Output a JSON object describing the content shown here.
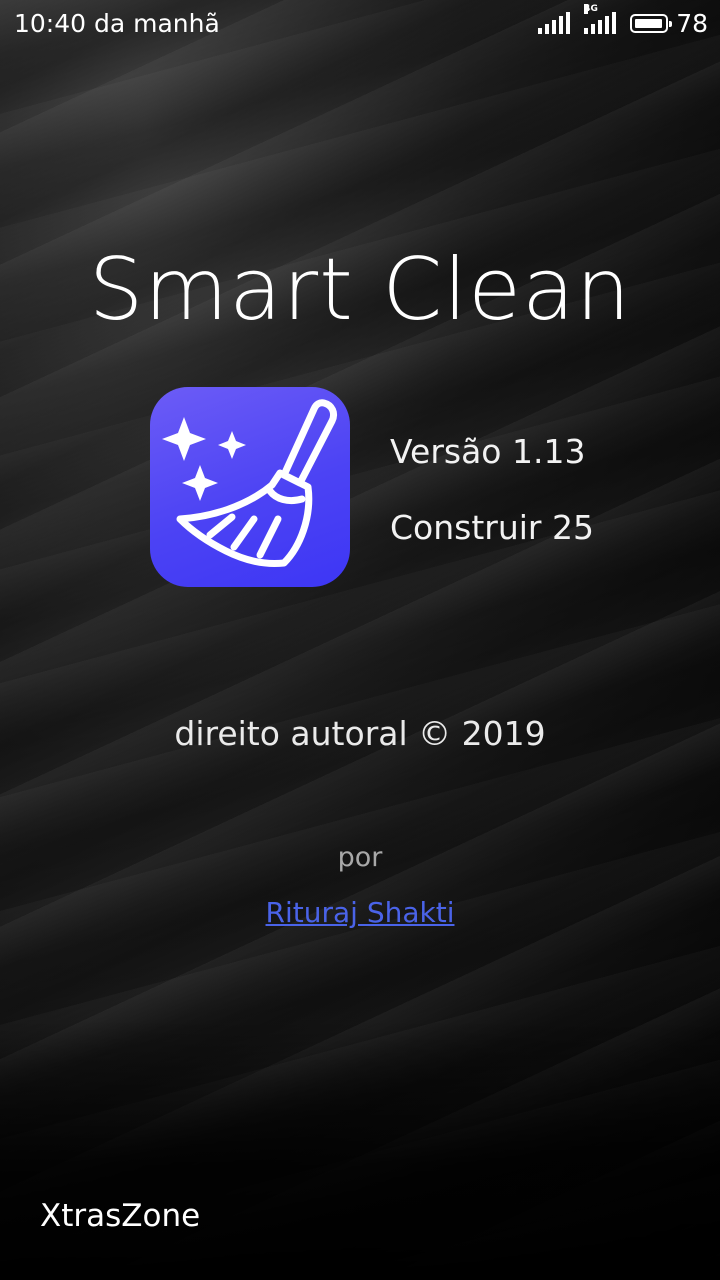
{
  "status_bar": {
    "time": "10:40 da manhã",
    "network_label": "4G",
    "battery_level": "78"
  },
  "app": {
    "title": "Smart Clean",
    "version": "Versão 1.13",
    "build": "Construir 25",
    "copyright": "direito autoral © 2019",
    "by_label": "por",
    "author": "Rituraj Shakti",
    "icon": "broom-sparkles-icon",
    "icon_gradient": [
      "#6c5cf6",
      "#3d36f5"
    ],
    "link_color": "#4a63e8"
  },
  "watermark": "XtrasZone"
}
